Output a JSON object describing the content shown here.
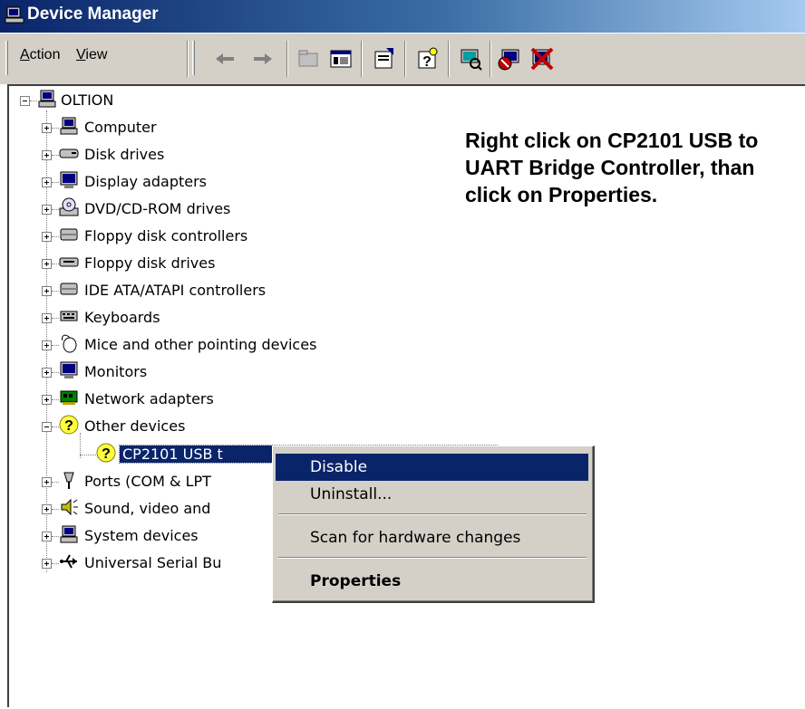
{
  "window": {
    "title": "Device Manager",
    "icon": "computer-icon"
  },
  "toolbar": {
    "menus": [
      {
        "label": "Action",
        "hotkey": "A"
      },
      {
        "label": "View",
        "hotkey": "V"
      }
    ],
    "buttons": [
      "back-arrow-icon",
      "forward-arrow-icon",
      "up-folder-icon",
      "show-hide-tree-icon",
      "properties-icon",
      "help-icon",
      "scan-hardware-icon",
      "uninstall-icon",
      "disable-icon"
    ]
  },
  "tree": {
    "root": "OLTION",
    "categories": [
      {
        "label": "Computer",
        "icon": "computer-icon"
      },
      {
        "label": "Disk drives",
        "icon": "disk-drive-icon"
      },
      {
        "label": "Display adapters",
        "icon": "monitor-icon"
      },
      {
        "label": "DVD/CD-ROM drives",
        "icon": "cdrom-icon"
      },
      {
        "label": "Floppy disk controllers",
        "icon": "controller-icon"
      },
      {
        "label": "Floppy disk drives",
        "icon": "floppy-icon"
      },
      {
        "label": "IDE ATA/ATAPI controllers",
        "icon": "controller-icon"
      },
      {
        "label": "Keyboards",
        "icon": "keyboard-icon"
      },
      {
        "label": "Mice and other pointing devices",
        "icon": "mouse-icon"
      },
      {
        "label": "Monitors",
        "icon": "monitor-icon"
      },
      {
        "label": "Network adapters",
        "icon": "network-card-icon"
      },
      {
        "label": "Other devices",
        "icon": "question-mark-icon"
      },
      {
        "label": "Ports (COM & LPT",
        "icon": "port-icon"
      },
      {
        "label": "Sound, video and",
        "icon": "speaker-icon"
      },
      {
        "label": "System devices",
        "icon": "computer-icon"
      },
      {
        "label": "Universal Serial Bu",
        "icon": "usb-icon"
      }
    ],
    "selected_child": "CP2101 USB t"
  },
  "instruction": "Right click on CP2101 USB to UART Bridge Controller, than click on Properties.",
  "context_menu": {
    "disable": "Disable",
    "uninstall": "Uninstall...",
    "scan": "Scan for hardware changes",
    "properties": "Properties"
  },
  "colors": {
    "highlight": "#0a246a",
    "face": "#d4d0c8",
    "title_start": "#0a246a",
    "title_end": "#a6caf0"
  }
}
